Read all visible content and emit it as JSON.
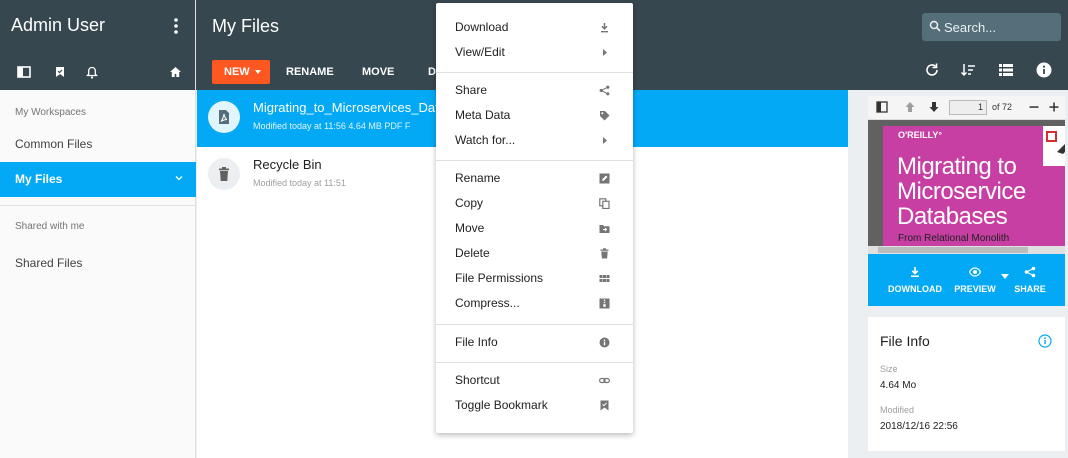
{
  "sidebar": {
    "user_name": "Admin User",
    "section_workspaces": "My Workspaces",
    "items": [
      {
        "label": "Common Files"
      },
      {
        "label": "My Files"
      }
    ],
    "section_shared": "Shared with me",
    "shared_items": [
      {
        "label": "Shared Files"
      }
    ],
    "icons": [
      "sidebar-toggle-icon",
      "bookmark-icon",
      "bell-icon",
      "home-icon"
    ]
  },
  "topbar": {
    "title": "My Files",
    "search_placeholder": "Search...",
    "new_label": "NEW",
    "toolbar": [
      "RENAME",
      "MOVE",
      "D"
    ],
    "icons": [
      "refresh-icon",
      "sort-icon",
      "list-view-icon",
      "info-icon"
    ]
  },
  "files": [
    {
      "name": "Migrating_to_Microservices_Data",
      "meta": "Modified today at 11:56   4.64 MB   PDF F"
    },
    {
      "name": "Recycle Bin",
      "meta": "Modified today at 11:51"
    }
  ],
  "context_menu": {
    "groups": [
      [
        {
          "label": "Download",
          "icon": "download-icon"
        },
        {
          "label": "View/Edit",
          "icon": "chevron-right-icon"
        }
      ],
      [
        {
          "label": "Share",
          "icon": "share-icon"
        },
        {
          "label": "Meta Data",
          "icon": "tag-icon"
        },
        {
          "label": "Watch for...",
          "icon": "chevron-right-icon"
        }
      ],
      [
        {
          "label": "Rename",
          "icon": "rename-icon"
        },
        {
          "label": "Copy",
          "icon": "copy-icon"
        },
        {
          "label": "Move",
          "icon": "move-folder-icon"
        },
        {
          "label": "Delete",
          "icon": "trash-icon"
        },
        {
          "label": "File Permissions",
          "icon": "grid-icon"
        },
        {
          "label": "Compress...",
          "icon": "archive-icon"
        }
      ],
      [
        {
          "label": "File Info",
          "icon": "info-icon"
        }
      ],
      [
        {
          "label": "Shortcut",
          "icon": "link-icon"
        },
        {
          "label": "Toggle Bookmark",
          "icon": "bookmark-icon"
        }
      ]
    ]
  },
  "preview": {
    "page": "1",
    "page_total": "of 72",
    "cover_publisher": "O'REILLY°",
    "cover_title_lines": [
      "Migrating to",
      "Microservice",
      "Databases"
    ],
    "cover_subtitle": "From Relational Monolith",
    "actions": [
      {
        "label": "DOWNLOAD",
        "icon": "download-icon"
      },
      {
        "label": "PREVIEW",
        "icon": "eye-icon"
      },
      {
        "label": "SHARE",
        "icon": "share-icon"
      }
    ]
  },
  "file_info": {
    "title": "File Info",
    "size_label": "Size",
    "size_value": "4.64 Mo",
    "modified_label": "Modified",
    "modified_value": "2018/12/16 22:56"
  },
  "colors": {
    "header": "#37474f",
    "accent": "#03a9f4",
    "new_button": "#ff5722",
    "cover": "#c73fa3"
  }
}
